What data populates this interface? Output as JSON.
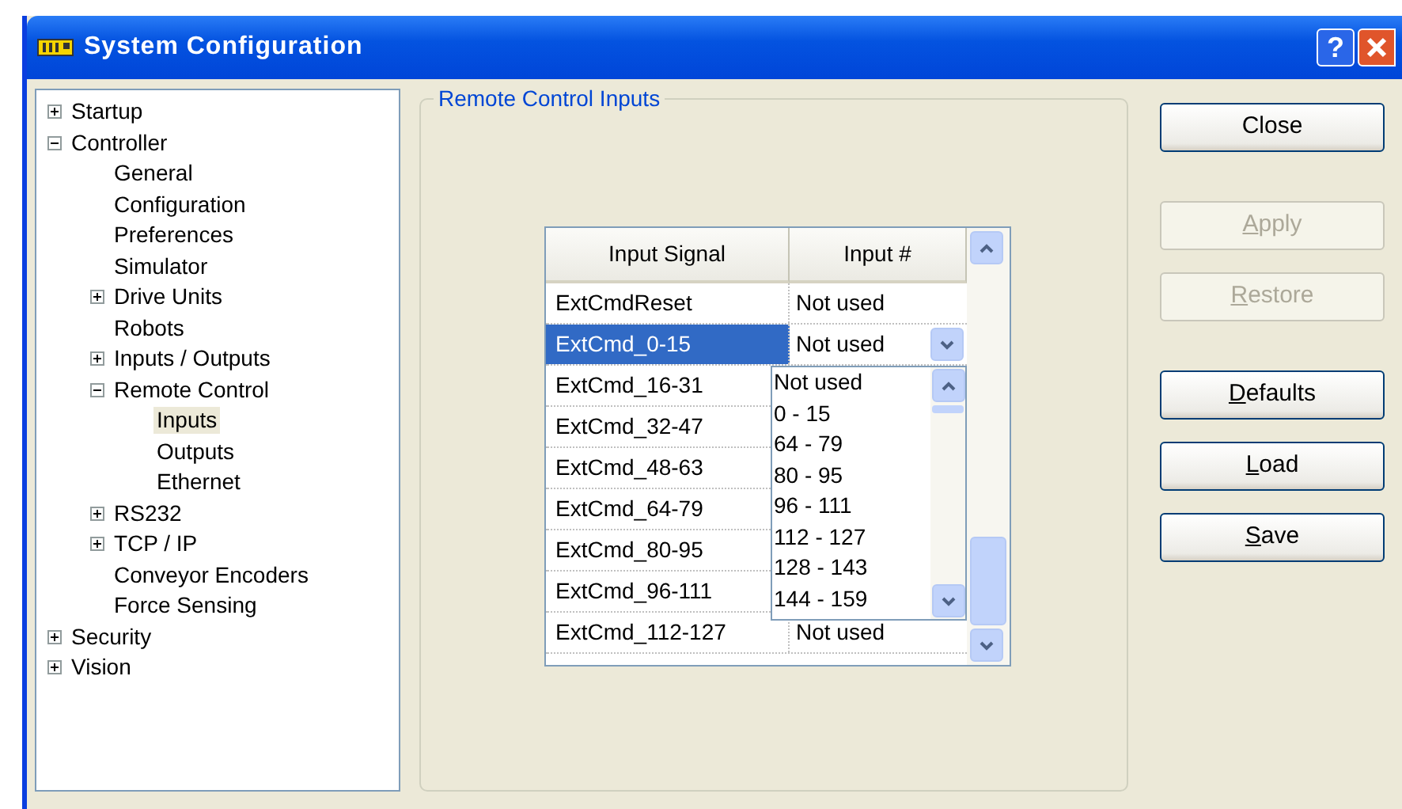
{
  "window": {
    "title": "System Configuration",
    "help": "?"
  },
  "tree": [
    {
      "label": "Startup",
      "expanded": false,
      "selected": false
    },
    {
      "label": "Controller",
      "expanded": true,
      "selected": false,
      "children": [
        {
          "label": "General",
          "selected": false
        },
        {
          "label": "Configuration",
          "selected": false
        },
        {
          "label": "Preferences",
          "selected": false
        },
        {
          "label": "Simulator",
          "selected": false
        },
        {
          "label": "Drive Units",
          "expanded": false,
          "selected": false
        },
        {
          "label": "Robots",
          "selected": false
        },
        {
          "label": "Inputs / Outputs",
          "expanded": false,
          "selected": false
        },
        {
          "label": "Remote Control",
          "expanded": true,
          "selected": false,
          "children": [
            {
              "label": "Inputs",
              "selected": true
            },
            {
              "label": "Outputs",
              "selected": false
            },
            {
              "label": "Ethernet",
              "selected": false
            }
          ]
        },
        {
          "label": "RS232",
          "expanded": false,
          "selected": false
        },
        {
          "label": "TCP / IP",
          "expanded": false,
          "selected": false
        },
        {
          "label": "Conveyor Encoders",
          "selected": false
        },
        {
          "label": "Force Sensing",
          "selected": false
        }
      ]
    },
    {
      "label": "Security",
      "expanded": false,
      "selected": false
    },
    {
      "label": "Vision",
      "expanded": false,
      "selected": false
    }
  ],
  "group": {
    "title": "Remote Control Inputs"
  },
  "table": {
    "columns": [
      "Input Signal",
      "Input #"
    ],
    "rows": [
      {
        "signal": "ExtCmdReset",
        "input": "Not used",
        "selected": false
      },
      {
        "signal": "ExtCmd_0-15",
        "input": "Not used",
        "selected": true,
        "dropdown_open": true
      },
      {
        "signal": "ExtCmd_16-31",
        "selected": false
      },
      {
        "signal": "ExtCmd_32-47",
        "selected": false
      },
      {
        "signal": "ExtCmd_48-63",
        "selected": false
      },
      {
        "signal": "ExtCmd_64-79",
        "selected": false
      },
      {
        "signal": "ExtCmd_80-95",
        "selected": false
      },
      {
        "signal": "ExtCmd_96-111",
        "selected": false
      },
      {
        "signal": "ExtCmd_112-127",
        "input": "Not used",
        "selected": false
      }
    ]
  },
  "dropdown": {
    "options": [
      "Not used",
      "0 - 15",
      "64 - 79",
      "80 - 95",
      "96 - 111",
      "112 - 127",
      "128 - 143",
      "144 - 159"
    ]
  },
  "button_groups": [
    [
      {
        "label": "Close",
        "disabled": false,
        "mnemonic": false
      }
    ],
    [
      {
        "label": "Apply",
        "disabled": true,
        "mnemonic": true
      },
      {
        "label": "Restore",
        "disabled": true,
        "mnemonic": true
      }
    ],
    [
      {
        "label": "Defaults",
        "disabled": false,
        "mnemonic": true
      },
      {
        "label": "Load",
        "disabled": false,
        "mnemonic": true
      },
      {
        "label": "Save",
        "disabled": false,
        "mnemonic": true
      }
    ]
  ]
}
